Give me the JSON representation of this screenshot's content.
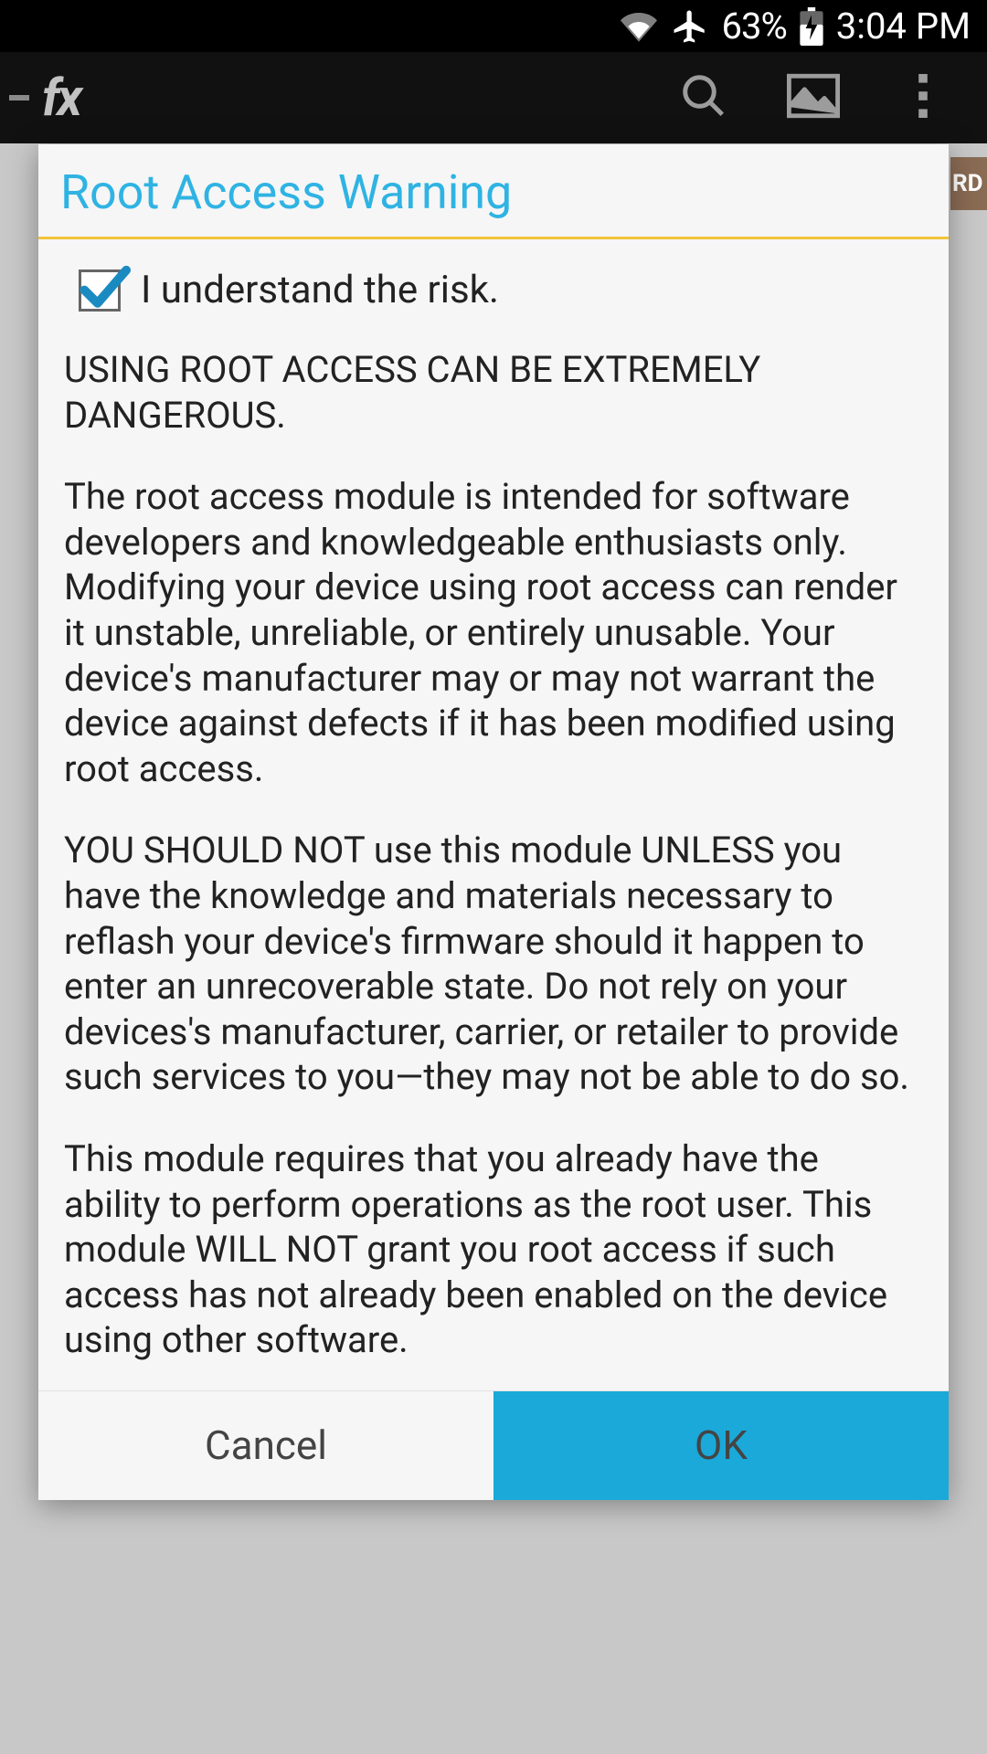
{
  "status": {
    "battery_pct": "63%",
    "time": "3:04 PM"
  },
  "toolbar": {
    "app_logo_text": "fx"
  },
  "behind": {
    "tab_fragment": "RD"
  },
  "dialog": {
    "title": "Root Access Warning",
    "checkbox_label": "I understand the risk.",
    "checkbox_checked": true,
    "paragraphs": {
      "p1": "USING ROOT ACCESS CAN BE EXTREMELY DANGEROUS.",
      "p2": "The root access module is intended for software developers and knowledgeable enthusiasts only. Modifying your device using root access can render it unstable, unreliable, or entirely unusable. Your device's manufacturer may or may not warrant the device against defects if it has been modified using root access.",
      "p3": "YOU SHOULD NOT use this module UNLESS you have the knowledge and materials necessary to reflash your device's firmware should it happen to enter an unrecoverable state. Do not rely on your devices's manufacturer, carrier, or retailer to provide such services to you—they may not be able to do so.",
      "p4": "This module requires that you already have the ability to perform operations as the root user. This module WILL NOT grant you root access if such access has not already been enabled on the device using other software."
    },
    "buttons": {
      "cancel": "Cancel",
      "ok": "OK"
    }
  }
}
